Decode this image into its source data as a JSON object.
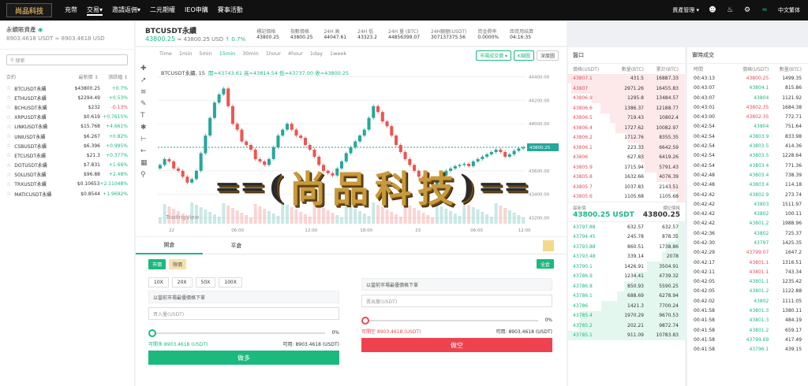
{
  "top": {
    "logo": "尚品科技",
    "nav": [
      "充幣",
      "交易▾",
      "邀請返佣▾",
      "二元期權",
      "IEO申購",
      "賽事活動"
    ],
    "right": [
      "資產管理 ▾",
      "中文繁体"
    ]
  },
  "wallet": {
    "title": "永續賬資產",
    "value": "8903.4618 USDT ≈ 8903.4618 USD"
  },
  "search_placeholder": "搜索",
  "market_head": [
    "合約",
    "最新價 ↕",
    "漲跌幅 ↕"
  ],
  "markets": [
    {
      "s": "BTCUSDT永續",
      "p": "$43800.25",
      "c": "+0.7%",
      "up": true
    },
    {
      "s": "ETHUSDT永續",
      "p": "$2294.49",
      "c": "+0.53%",
      "up": true
    },
    {
      "s": "BCHUSDT永續",
      "p": "$232",
      "c": "-0.13%",
      "up": false
    },
    {
      "s": "XRPUSDT永續",
      "p": "$0.619",
      "c": "+0.7615%",
      "up": true
    },
    {
      "s": "LINKUSDT永續",
      "p": "$15.768",
      "c": "+4.661%",
      "up": true
    },
    {
      "s": "UNIUSDT永續",
      "p": "$6.267",
      "c": "+0.82%",
      "up": true
    },
    {
      "s": "CSBUSDT永續",
      "p": "$6.396",
      "c": "+0.995%",
      "up": true
    },
    {
      "s": "ETCUSDT永續",
      "p": "$21.3",
      "c": "+0.377%",
      "up": true
    },
    {
      "s": "DOTUSDT永續",
      "p": "$7.831",
      "c": "+1.66%",
      "up": true
    },
    {
      "s": "SOLUSDT永續",
      "p": "$96.88",
      "c": "+2.48%",
      "up": true
    },
    {
      "s": "TRXUSDT永續",
      "p": "$0.10653",
      "c": "+2.11048%",
      "up": true
    },
    {
      "s": "MATICUSDT永續",
      "p": "$0.8544",
      "c": "+1.9692%",
      "up": true
    }
  ],
  "ticker": {
    "symbol": "BTCUSDT永續",
    "price": "43800.25",
    "price_usd": "≈ 43800.25 USD",
    "change": "↑ 0.7%",
    "stats": [
      {
        "k": "標記價格",
        "v": "43800.25"
      },
      {
        "k": "指數價格",
        "v": "43800.25"
      },
      {
        "k": "24H 高",
        "v": "44047.61"
      },
      {
        "k": "24H 低",
        "v": "43323.2"
      },
      {
        "k": "24H 量 (BTC)",
        "v": "44856399.07"
      },
      {
        "k": "24H額額(USDT)",
        "v": "307137375.56"
      },
      {
        "k": "資金費率",
        "v": "0.0000%"
      },
      {
        "k": "距資用結算",
        "v": "04:16:35"
      }
    ]
  },
  "chart": {
    "timeframes": [
      "Time",
      "1min",
      "5min",
      "15min",
      "30min",
      "1hour",
      "4hour",
      "1day",
      "1week"
    ],
    "active": "15min",
    "buttons": [
      "市場成交價 ▾",
      "K線圖",
      "深度圖"
    ],
    "ohlc_label": "BTCUSDT永續, 15",
    "o": "開=43743.61",
    "h": "高=43814.54",
    "l": "低=43737.00",
    "c": "收=43800.25",
    "y_ticks": [
      "44400.00",
      "44200.00",
      "44000.00",
      "43800.25",
      "43600.00",
      "43400.00",
      "43200.00"
    ],
    "x_ticks": [
      "22",
      "06:00",
      "12:00",
      "18:00",
      "23",
      "06:00",
      "12:00"
    ],
    "last": "43800.25",
    "brand": "TradingView"
  },
  "chart_data": {
    "type": "candlestick",
    "title": "BTCUSDT永續, 15",
    "ylim": [
      43150,
      44450
    ],
    "y_ticks": [
      "44400.00",
      "44200.00",
      "44000.00",
      "43800.25",
      "43600.00",
      "43400.00",
      "43200.00"
    ],
    "x_ticks": [
      "22",
      "06:00",
      "12:00",
      "18:00",
      "23",
      "06:00",
      "12:00"
    ],
    "close": [
      43650,
      43700,
      43680,
      43620,
      43600,
      43550,
      43500,
      43530,
      43600,
      43750,
      43900,
      44050,
      44180,
      44250,
      44300,
      44150,
      44000,
      43950,
      43850,
      43820,
      43780,
      43700,
      43680,
      43650,
      43700,
      43800,
      43900,
      43950,
      44000,
      43950,
      43900,
      43880,
      43820,
      43780,
      43720,
      43650,
      43600,
      43580,
      43560,
      43620,
      43680,
      43750,
      43800,
      43850,
      43900,
      43950,
      44050,
      44150,
      44100,
      44020,
      43980,
      43900,
      43820,
      43760,
      43700,
      43650,
      43600,
      43550,
      43520,
      43500,
      43480,
      43520,
      43560,
      43600,
      43620,
      43640,
      43650,
      43660,
      43640,
      43680,
      43700,
      43720,
      43740,
      43760,
      43780,
      43760,
      43720,
      43740,
      43770,
      43790,
      43800
    ]
  },
  "order": {
    "tabs": [
      "開倉",
      "平倉"
    ],
    "types": [
      "市價",
      "限價"
    ],
    "mode": "全倉",
    "lev": [
      "10X",
      "20X",
      "50X",
      "100X"
    ],
    "buy": {
      "price_hint": "以當前市場最優價格下單",
      "qty_hint": "買入量(USDT)",
      "pct": "0%",
      "open": "可開多 8903.4618 (USDT)",
      "avail": "可用: 8903.4618 (USDT)",
      "btn": "做多"
    },
    "sell": {
      "price_hint": "以當前市場最優價格下單",
      "qty_hint": "賣出量(USDT)",
      "pct": "0%",
      "open": "可開空 8903.4618 (USDT)",
      "avail": "可用: 8903.4618 (USDT)",
      "btn": "做空"
    }
  },
  "book": {
    "title": "盤口",
    "head": [
      "價格(USDT)",
      "數量(BTC)",
      "累計(BTC)"
    ],
    "asks": [
      [
        "43807.1",
        "431.5",
        "16887.33"
      ],
      [
        "43807",
        "2971.26",
        "16455.83"
      ],
      [
        "43806.9",
        "1295.8",
        "13484.57"
      ],
      [
        "43806.6",
        "1386.37",
        "12188.77"
      ],
      [
        "43806.5",
        "719.43",
        "10802.4"
      ],
      [
        "43806.4",
        "1727.62",
        "10082.97"
      ],
      [
        "43806.2",
        "1712.76",
        "8355.35"
      ],
      [
        "43806.1",
        "223.33",
        "6642.59"
      ],
      [
        "43806",
        "627.83",
        "6419.26"
      ],
      [
        "43805.9",
        "1715.94",
        "5791.43"
      ],
      [
        "43805.8",
        "1632.66",
        "4076.39"
      ],
      [
        "43805.7",
        "1037.83",
        "2143.51"
      ],
      [
        "43805.6",
        "1105.68",
        "1105.68"
      ]
    ],
    "mid_label": "最新價",
    "mid_price": "43800.25 USDT",
    "mid_mark_label": "標記價格",
    "mid_mark": "43800.25",
    "bids": [
      [
        "43797.88",
        "632.57",
        "632.57"
      ],
      [
        "43794.45",
        "245.78",
        "878.35"
      ],
      [
        "43793.88",
        "860.51",
        "1738.86"
      ],
      [
        "43793.48",
        "339.14",
        "2078"
      ],
      [
        "43790.1",
        "1426.91",
        "3504.91"
      ],
      [
        "43786.9",
        "1234.41",
        "4739.32"
      ],
      [
        "43786.8",
        "850.93",
        "5590.25"
      ],
      [
        "43786.1",
        "688.69",
        "6278.94"
      ],
      [
        "43786",
        "1421.3",
        "7700.24"
      ],
      [
        "43785.4",
        "1970.29",
        "9670.53"
      ],
      [
        "43785.2",
        "202.21",
        "9872.74"
      ],
      [
        "43785.1",
        "911.09",
        "10783.83"
      ]
    ]
  },
  "trades": {
    "title": "實時成交",
    "head": [
      "時間",
      "價格(USDT)",
      "數量(BTC)"
    ],
    "rows": [
      [
        "00:43:13",
        "43800.25",
        "1499.35",
        false
      ],
      [
        "00:43:07",
        "43804.1",
        "815.86",
        true
      ],
      [
        "00:43:07",
        "43804",
        "1121.92",
        true
      ],
      [
        "00:43:01",
        "43802.35",
        "1684.38",
        false
      ],
      [
        "00:43:00",
        "43802.35",
        "772.71",
        false
      ],
      [
        "00:42:54",
        "43804",
        "751.64",
        true
      ],
      [
        "00:42:54",
        "43803.9",
        "833.98",
        true
      ],
      [
        "00:42:54",
        "43803.5",
        "414.36",
        true
      ],
      [
        "00:42:54",
        "43803.5",
        "1228.64",
        true
      ],
      [
        "00:42:54",
        "43803.4",
        "771.36",
        true
      ],
      [
        "00:42:48",
        "43803.4",
        "738.39",
        true
      ],
      [
        "00:42:48",
        "43803.4",
        "114.18",
        true
      ],
      [
        "00:42:42",
        "43802.9",
        "273.74",
        true
      ],
      [
        "00:42:42",
        "43803",
        "1511.97",
        true
      ],
      [
        "00:42:42",
        "43802",
        "100.11",
        true
      ],
      [
        "00:42:42",
        "43801.2",
        "1988.96",
        true
      ],
      [
        "00:42:36",
        "43802",
        "725.37",
        true
      ],
      [
        "00:42:30",
        "43797",
        "1425.35",
        true
      ],
      [
        "00:42:29",
        "43799.07",
        "1647.2",
        false
      ],
      [
        "00:42:17",
        "43801.1",
        "1316.51",
        false
      ],
      [
        "00:42:11",
        "43801.1",
        "743.34",
        false
      ],
      [
        "00:42:05",
        "43801.1",
        "1235.42",
        true
      ],
      [
        "00:42:05",
        "43801.2",
        "1122.88",
        true
      ],
      [
        "00:42:02",
        "43802",
        "1111.05",
        true
      ],
      [
        "00:41:58",
        "43801.3",
        "1380.11",
        true
      ],
      [
        "00:41:58",
        "43801.3",
        "484.19",
        true
      ],
      [
        "00:41:58",
        "43801.2",
        "659.17",
        true
      ],
      [
        "00:41:58",
        "43799.69",
        "417.49",
        true
      ],
      [
        "00:41:58",
        "43796.1",
        "439.15",
        true
      ]
    ]
  },
  "watermark": "尚品科技"
}
